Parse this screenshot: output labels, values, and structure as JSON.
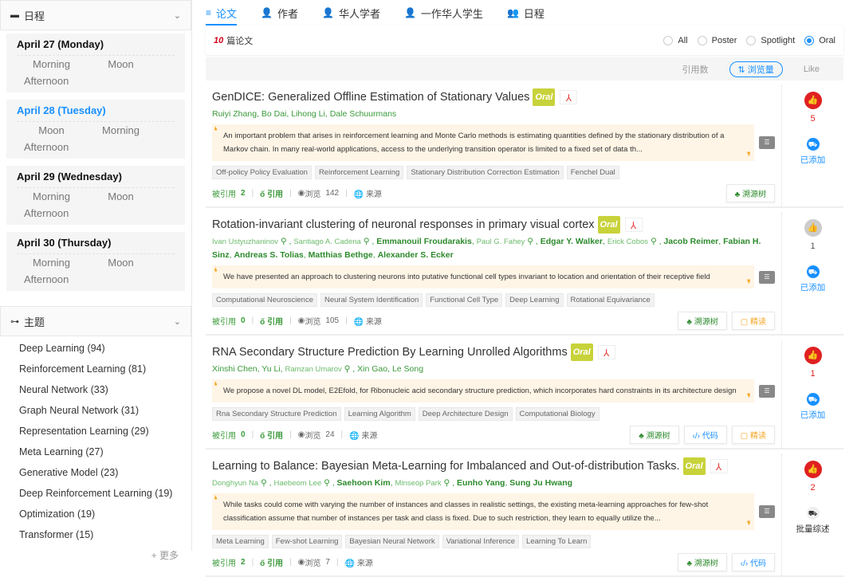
{
  "sidebar": {
    "schedule_title": "日程",
    "days": [
      {
        "title": "April 27 (Monday)",
        "slots": [
          "Morning",
          "Moon",
          "Afternoon"
        ]
      },
      {
        "title": "April 28 (Tuesday)",
        "slots": [
          "Moon",
          "Morning",
          "Afternoon"
        ]
      },
      {
        "title": "April 29 (Wednesday)",
        "slots": [
          "Morning",
          "Moon",
          "Afternoon"
        ]
      },
      {
        "title": "April 30 (Thursday)",
        "slots": [
          "Morning",
          "Moon",
          "Afternoon"
        ]
      }
    ],
    "topics_title": "主题",
    "topics": [
      "Deep Learning (94)",
      "Reinforcement Learning (81)",
      "Neural Network (33)",
      "Graph Neural Network (31)",
      "Representation Learning (29)",
      "Meta Learning (27)",
      "Generative Model (23)",
      "Deep Reinforcement Learning (19)",
      "Optimization (19)",
      "Transformer (15)"
    ],
    "more": "+ 更多"
  },
  "tabs": [
    "论文",
    "作者",
    "华人学者",
    "一作华人学生",
    "日程"
  ],
  "count": {
    "num": "10",
    "label": "篇论文"
  },
  "filters": [
    "All",
    "Poster",
    "Spotlight",
    "Oral"
  ],
  "sort": [
    "引用数",
    "⇅ 浏览量",
    "Like"
  ],
  "labels": {
    "oral": "Oral",
    "cited": "被引用",
    "cite": "引用",
    "views": "浏览",
    "source": "来源",
    "tree": "溯源树",
    "code": "代码",
    "read": "精读",
    "added": "已添加",
    "batch": "批量综述"
  },
  "papers": [
    {
      "title": "GenDICE: Generalized Offline Estimation of Stationary Values",
      "authors": [
        {
          "n": "Ruiyi Zhang"
        },
        {
          "n": "Bo Dai"
        },
        {
          "n": "Lihong Li"
        },
        {
          "n": "Dale Schuurmans"
        }
      ],
      "abstract": "An important problem that arises in reinforcement learning and Monte Carlo methods is estimating quantities defined by the stationary distribution of a Markov chain. In many real-world applications, access to the underlying transition operator is limited to a fixed set of data th...",
      "tags": [
        "Off-policy Policy Evaluation",
        "Reinforcement Learning",
        "Stationary Distribution Correction Estimation",
        "Fenchel Dual"
      ],
      "cited": "2",
      "views": "142",
      "likes": "5",
      "liked": true,
      "added": true,
      "actions": [
        "tree"
      ]
    },
    {
      "title": "Rotation-invariant clustering of neuronal responses in primary visual cortex",
      "authors": [
        {
          "n": "Ivan Ustyuzhaninov",
          "lite": true
        },
        {
          "n": "Santiago A. Cadena",
          "lite": true
        },
        {
          "n": "Emmanouil Froudarakis",
          "bold": true
        },
        {
          "n": "Paul G. Fahey",
          "lite": true
        },
        {
          "n": "Edgar Y. Walker",
          "bold": true
        },
        {
          "n": "Erick Cobos",
          "lite": true
        },
        {
          "n": "Jacob Reimer",
          "bold": true
        },
        {
          "n": "Fabian H. Sinz",
          "bold": true
        },
        {
          "n": "Andreas S. Tolias",
          "bold": true
        },
        {
          "n": "Matthias Bethge",
          "bold": true
        },
        {
          "n": "Alexander S. Ecker",
          "bold": true
        }
      ],
      "abstract": "We have presented an approach to clustering neurons into putative functional cell types invariant to location and orientation of their receptive field",
      "tags": [
        "Computational Neuroscience",
        "Neural System Identification",
        "Functional Cell Type",
        "Deep Learning",
        "Rotational Equivariance"
      ],
      "cited": "0",
      "views": "105",
      "likes": "1",
      "liked": false,
      "added": true,
      "actions": [
        "tree",
        "read"
      ]
    },
    {
      "title": "RNA Secondary Structure Prediction By Learning Unrolled Algorithms",
      "authors": [
        {
          "n": "Xinshi Chen"
        },
        {
          "n": "Yu Li"
        },
        {
          "n": "Ramzan Umarov",
          "lite": true
        },
        {
          "n": "Xin Gao"
        },
        {
          "n": "Le Song"
        }
      ],
      "abstract": "We propose a novel DL model, E2Efold, for Ribonucleic acid secondary structure prediction, which incorporates hard constraints in its architecture design",
      "tags": [
        "Rna Secondary Structure Prediction",
        "Learning Algorithm",
        "Deep Architecture Design",
        "Computational Biology"
      ],
      "cited": "0",
      "views": "24",
      "likes": "1",
      "liked": true,
      "added": true,
      "actions": [
        "tree",
        "code",
        "read"
      ]
    },
    {
      "title": "Learning to Balance: Bayesian Meta-Learning for Imbalanced and Out-of-distribution Tasks.",
      "authors": [
        {
          "n": "Donghyun Na",
          "lite": true
        },
        {
          "n": "Haebeom Lee",
          "lite": true
        },
        {
          "n": "Saehoon Kim",
          "bold": true
        },
        {
          "n": "Minseop Park",
          "lite": true
        },
        {
          "n": "Eunho Yang",
          "bold": true
        },
        {
          "n": "Sung Ju Hwang",
          "bold": true
        }
      ],
      "abstract": "While tasks could come with varying the number of instances and classes in realistic settings, the existing meta-learning approaches for few-shot classification assume that number of instances per task and class is fixed. Due to such restriction, they learn to equally utilize the...",
      "tags": [
        "Meta Learning",
        "Few-shot Learning",
        "Bayesian Neural Network",
        "Variational Inference",
        "Learning To Learn"
      ],
      "cited": "2",
      "views": "7",
      "likes": "2",
      "liked": true,
      "added": false,
      "actions": [
        "tree",
        "code"
      ]
    }
  ]
}
